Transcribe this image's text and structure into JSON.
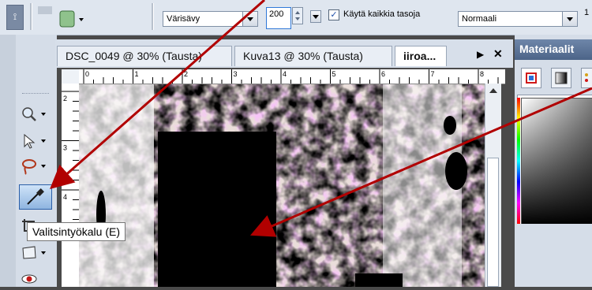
{
  "toolbar": {
    "pin_icon": "pin-icon",
    "tool_icon": "selection-tool-icon",
    "mode_value": "Värisävy",
    "tolerance_value": "200",
    "all_layers_label": "Käytä kaikkia tasoja",
    "all_layers_checked": true,
    "blend_value": "Normaali",
    "truncated_value": "1"
  },
  "tabs": [
    {
      "label": "DSC_0049 @  30% (Tausta)"
    },
    {
      "label": "Kuva13 @  30% (Tausta)"
    },
    {
      "label": "iiroa..."
    }
  ],
  "tab_controls": {
    "next_icon": "▶",
    "close_icon": "✕"
  },
  "ruler": {
    "h_labels": [
      "0",
      "1",
      "2",
      "3",
      "4",
      "5",
      "6",
      "7",
      "8"
    ],
    "v_labels": [
      "2",
      "3",
      "4"
    ]
  },
  "tools": [
    {
      "name": "zoom-icon",
      "glyph": "🔍"
    },
    {
      "name": "pointer-icon",
      "glyph": "⇱"
    },
    {
      "name": "lasso-icon",
      "glyph": "ϙ"
    },
    {
      "name": "eyedropper-icon",
      "glyph": "✎"
    },
    {
      "name": "crop-icon",
      "glyph": "⌧"
    },
    {
      "name": "transform-icon",
      "glyph": "◫"
    },
    {
      "name": "redeye-icon",
      "glyph": "👁"
    }
  ],
  "tooltip": "Valitsintyökalu (E)",
  "materials": {
    "title": "Materiaalit",
    "tab_icons": [
      "frame-icon",
      "gradient-icon",
      "pattern-icon"
    ]
  },
  "colors": {
    "accent": "#2f78d8",
    "arrow": "#b10000",
    "panel_title": "#5a729a"
  }
}
